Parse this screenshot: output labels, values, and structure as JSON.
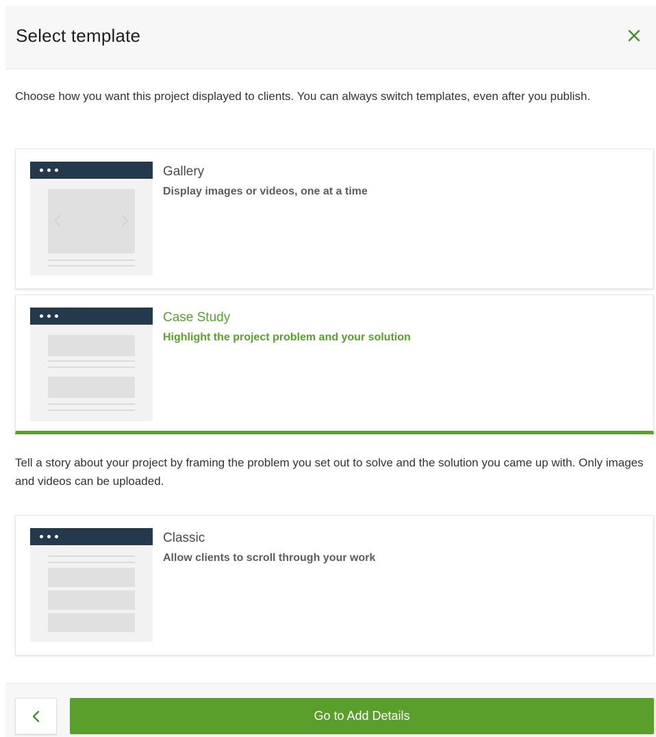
{
  "header": {
    "title": "Select template",
    "close_icon": "close-icon"
  },
  "intro": "Choose how you want this project displayed to clients. You can always switch templates, even after you publish.",
  "templates": [
    {
      "name": "Gallery",
      "description": "Display images or videos, one at a time",
      "selected": false,
      "thumbnail": "gallery-thumbnail"
    },
    {
      "name": "Case Study",
      "description": "Highlight the project problem and your solution",
      "selected": true,
      "thumbnail": "case-study-thumbnail"
    },
    {
      "name": "Classic",
      "description": "Allow clients to scroll through your work",
      "selected": false,
      "thumbnail": "classic-thumbnail"
    }
  ],
  "selected_detail": "Tell a story about your project by framing the problem you set out to solve and the solution you came up with. Only images and videos can be uploaded.",
  "footer": {
    "back_icon": "chevron-left-icon",
    "primary_label": "Go to Add Details"
  },
  "colors": {
    "accent": "#5a9e2c",
    "thumbnail_bar": "#24394c",
    "header_bg": "#f7f7f7"
  }
}
